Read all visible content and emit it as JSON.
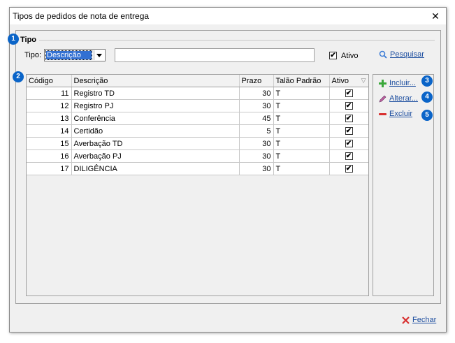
{
  "window": {
    "title": "Tipos de pedidos de nota de entrega",
    "close_glyph": "✕"
  },
  "badges": {
    "b1": "1",
    "b2": "2",
    "b3": "3",
    "b4": "4",
    "b5": "5"
  },
  "group": {
    "title": "Tipo"
  },
  "filter": {
    "tipo_label": "Tipo:",
    "combo_value": "Descrição",
    "search_value": "",
    "ativo_label": "Ativo",
    "ativo_checked": true,
    "pesquisar_label": "Pesquisar",
    "check_glyph": "✔"
  },
  "table": {
    "columns": [
      "Código",
      "Descrição",
      "Prazo",
      "Talão Padrão",
      "Ativo"
    ],
    "sort_glyph": "▽",
    "rows": [
      {
        "codigo": "11",
        "descricao": "Registro TD",
        "prazo": "30",
        "talao": "T",
        "ativo": "✔"
      },
      {
        "codigo": "12",
        "descricao": "Registro PJ",
        "prazo": "30",
        "talao": "T",
        "ativo": "✔"
      },
      {
        "codigo": "13",
        "descricao": "Conferência",
        "prazo": "45",
        "talao": "T",
        "ativo": "✔"
      },
      {
        "codigo": "14",
        "descricao": "Certidão",
        "prazo": "5",
        "talao": "T",
        "ativo": "✔"
      },
      {
        "codigo": "15",
        "descricao": "Averbação TD",
        "prazo": "30",
        "talao": "T",
        "ativo": "✔"
      },
      {
        "codigo": "16",
        "descricao": "Averbação PJ",
        "prazo": "30",
        "talao": "T",
        "ativo": "✔"
      },
      {
        "codigo": "17",
        "descricao": "DILIGÊNCIA",
        "prazo": "30",
        "talao": "T",
        "ativo": "✔"
      }
    ]
  },
  "actions": {
    "incluir": "Incluir...",
    "alterar": "Alterar...",
    "excluir": "Excluir",
    "fechar": "Fechar"
  },
  "icons": {
    "plus": "plus-icon",
    "pencil": "pencil-icon",
    "minus": "minus-icon",
    "search": "search-icon",
    "close_x": "close-x-icon"
  },
  "colors": {
    "accent": "#0a64c8",
    "link": "#1e4fa0",
    "selection": "#3270d2",
    "plus": "#3aa83a",
    "minus": "#d83030",
    "fechar_x": "#d83030"
  }
}
